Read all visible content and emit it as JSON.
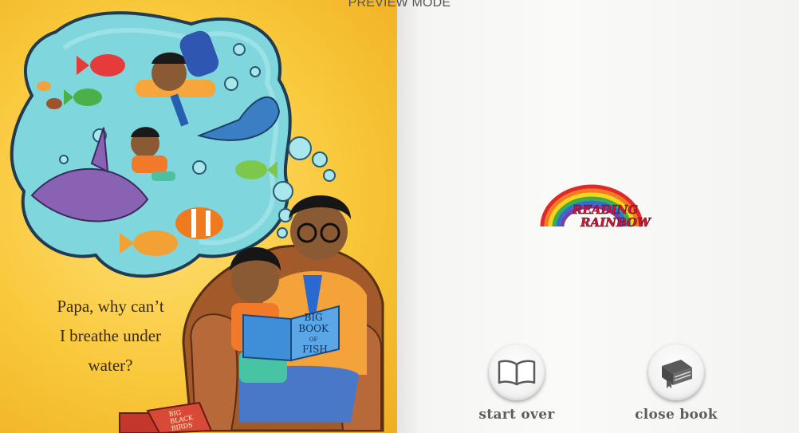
{
  "header": {
    "mode_label": "PREVIEW MODE"
  },
  "left_page": {
    "story_lines": [
      "Papa, why can’t",
      "I breathe under",
      "water?"
    ],
    "book_cover_text": [
      "BIG",
      "BOOK",
      "OF",
      "FISH"
    ],
    "floor_book_text": [
      "BIG",
      "BLACK",
      "BIRDS"
    ]
  },
  "right_page": {
    "logo_text": [
      "READING",
      "RAINBOW"
    ]
  },
  "actions": {
    "start_over": {
      "label": "start over",
      "icon": "open-book-icon"
    },
    "close_book": {
      "label": "close book",
      "icon": "closed-book-icon"
    }
  },
  "colors": {
    "page_yellow": "#f9c83b",
    "bubble_water": "#7fd6dc",
    "rainbow": [
      "#e02a2a",
      "#f47b20",
      "#f8d41b",
      "#3cae49",
      "#2f6fd1",
      "#7a3fa6"
    ],
    "logo_text": "#d1183a"
  }
}
